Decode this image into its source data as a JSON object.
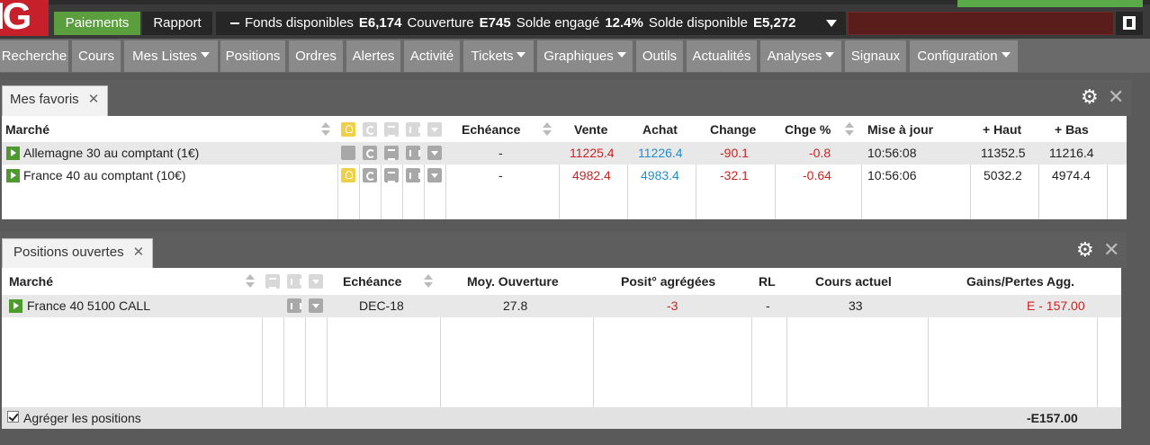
{
  "topbar": {
    "logo_text": "IG",
    "payments_label": "Paiements",
    "report_label": "Rapport",
    "funds": [
      {
        "label": "Fonds disponibles",
        "value": "E6,174"
      },
      {
        "label": "Couverture",
        "value": "E745"
      },
      {
        "label": "Solde engagé",
        "value": "12.4%"
      },
      {
        "label": "Solde disponible",
        "value": "E5,272"
      }
    ]
  },
  "menu": {
    "items": [
      {
        "label": "Recherche",
        "dropdown": false
      },
      {
        "label": "Cours",
        "dropdown": false
      },
      {
        "label": "Mes Listes",
        "dropdown": true
      },
      {
        "label": "Positions",
        "dropdown": false
      },
      {
        "label": "Ordres",
        "dropdown": false
      },
      {
        "label": "Alertes",
        "dropdown": false
      },
      {
        "label": "Activité",
        "dropdown": false
      },
      {
        "label": "Tickets",
        "dropdown": true
      },
      {
        "label": "Graphiques",
        "dropdown": true
      },
      {
        "label": "Outils",
        "dropdown": false
      },
      {
        "label": "Actualités",
        "dropdown": false
      },
      {
        "label": "Analyses",
        "dropdown": true
      },
      {
        "label": "Signaux",
        "dropdown": false
      },
      {
        "label": "Configuration",
        "dropdown": true
      }
    ]
  },
  "favorites": {
    "tab_label": "Mes favoris",
    "columns": {
      "market": "Marché",
      "expiry": "Echéance",
      "sell": "Vente",
      "buy": "Achat",
      "change": "Change",
      "change_pct": "Chge %",
      "updated": "Mise à jour",
      "high": "+ Haut",
      "low": "+ Bas"
    },
    "rows": [
      {
        "market": "Allemagne 30 au comptant (1€)",
        "expiry": "-",
        "sell": "11225.4",
        "buy": "11226.4",
        "change": "-90.1",
        "change_pct": "-0.8",
        "updated": "10:56:08",
        "high": "11352.5",
        "low": "11216.4"
      },
      {
        "market": "France 40 au comptant (10€)",
        "expiry": "-",
        "sell": "4982.4",
        "buy": "4983.4",
        "change": "-32.1",
        "change_pct": "-0.64",
        "updated": "10:56:06",
        "high": "5032.2",
        "low": "4974.4"
      }
    ]
  },
  "positions": {
    "tab_label": "Positions ouvertes",
    "columns": {
      "market": "Marché",
      "expiry": "Echéance",
      "avg_open": "Moy. Ouverture",
      "aggregated": "Posit° agrégées",
      "rl": "RL",
      "current": "Cours actuel",
      "pnl": "Gains/Pertes Agg."
    },
    "rows": [
      {
        "market": "France 40 5100 CALL",
        "expiry": "DEC-18",
        "avg_open": "27.8",
        "aggregated": "-3",
        "rl": "-",
        "current": "33",
        "pnl": "E - 157.00"
      }
    ],
    "aggregate_label": "Agréger les positions",
    "total": "-E157.00"
  },
  "colors": {
    "accent_green": "#5a9e3e",
    "brand_red": "#c8202a",
    "negative": "#cc2222",
    "buy_blue": "#1f8fd0"
  }
}
